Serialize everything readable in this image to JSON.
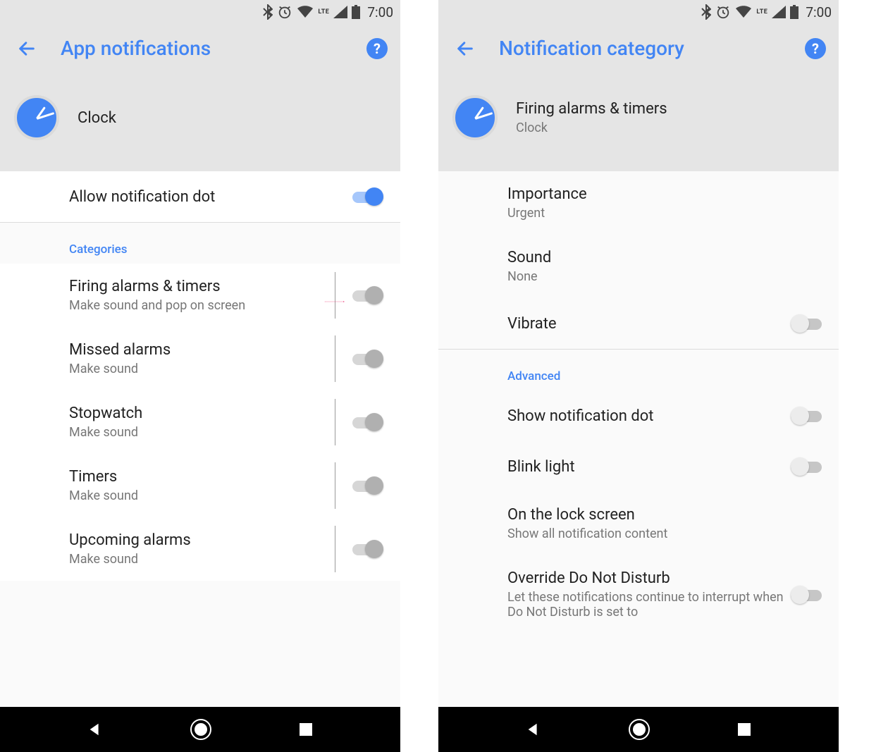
{
  "status": {
    "lte": "LTE",
    "time": "7:00"
  },
  "left": {
    "title": "App notifications",
    "app_name": "Clock",
    "allow_dot": "Allow notification dot",
    "categories_header": "Categories",
    "categories": [
      {
        "title": "Firing alarms & timers",
        "subtitle": "Make sound and pop on screen"
      },
      {
        "title": "Missed alarms",
        "subtitle": "Make sound"
      },
      {
        "title": "Stopwatch",
        "subtitle": "Make sound"
      },
      {
        "title": "Timers",
        "subtitle": "Make sound"
      },
      {
        "title": "Upcoming alarms",
        "subtitle": "Make sound"
      }
    ]
  },
  "right": {
    "title": "Notification category",
    "header_primary": "Firing alarms & timers",
    "header_secondary": "Clock",
    "rows": {
      "importance_label": "Importance",
      "importance_value": "Urgent",
      "sound_label": "Sound",
      "sound_value": "None",
      "vibrate_label": "Vibrate"
    },
    "advanced_header": "Advanced",
    "advanced": {
      "show_dot": "Show notification dot",
      "blink_light": "Blink light",
      "lock_label": "On the lock screen",
      "lock_value": "Show all notification content",
      "override_label": "Override Do Not Disturb",
      "override_value": "Let these notifications continue to interrupt when Do Not Disturb is set to"
    }
  }
}
